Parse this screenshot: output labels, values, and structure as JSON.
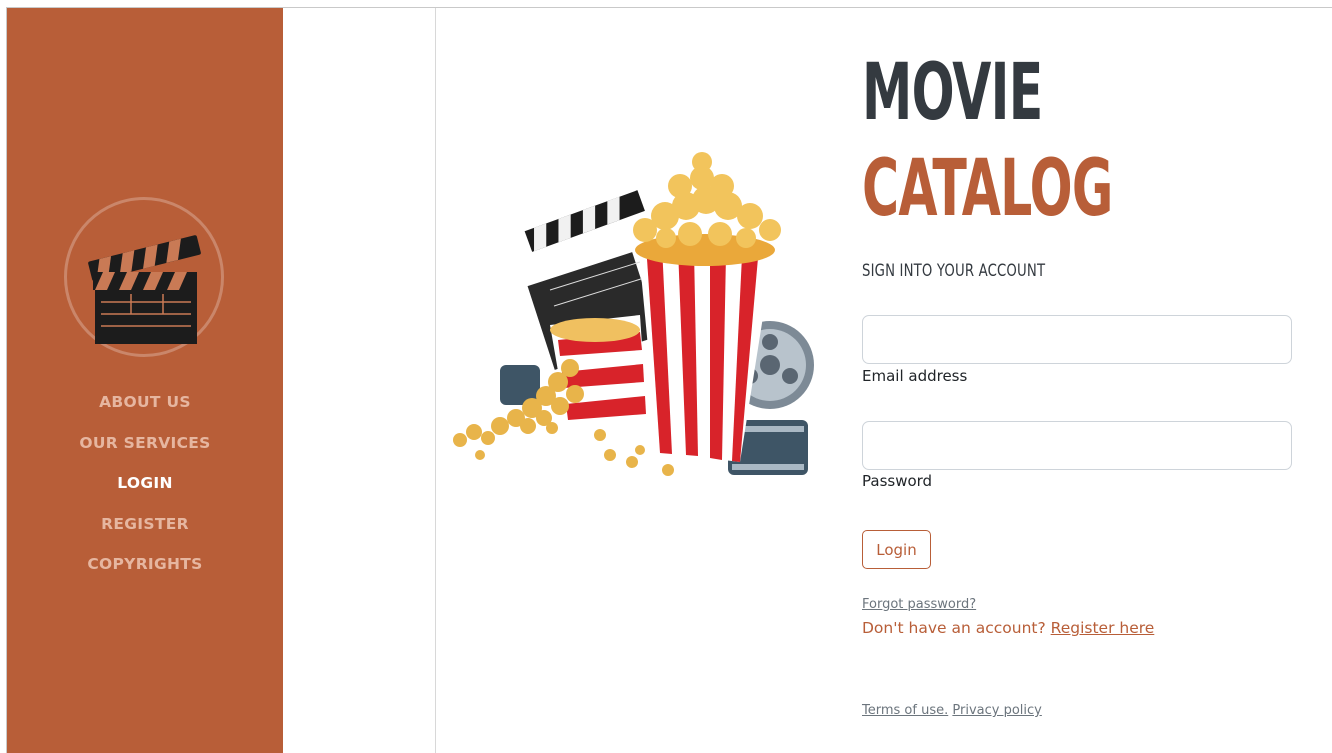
{
  "sidebar": {
    "logo_icon": "clapperboard-icon",
    "nav": [
      {
        "label": "ABOUT US",
        "active": false
      },
      {
        "label": "OUR SERVICES",
        "active": false
      },
      {
        "label": "LOGIN",
        "active": true
      },
      {
        "label": "REGISTER",
        "active": false
      },
      {
        "label": "COPYRIGHTS",
        "active": false
      }
    ]
  },
  "hero": {
    "image": "popcorn-clapperboard-film-reel-illustration"
  },
  "header": {
    "title_line1": "MOVIE",
    "title_line2": "CATALOG",
    "subtitle": "SIGN INTO YOUR ACCOUNT"
  },
  "form": {
    "email": {
      "value": "",
      "placeholder": "",
      "label": "Email address"
    },
    "password": {
      "value": "",
      "placeholder": "",
      "label": "Password"
    },
    "login_label": "Login",
    "forgot_label": "Forgot password?",
    "no_account_text": "Don't have an account? ",
    "register_link": "Register here"
  },
  "footer": {
    "terms": "Terms of use.",
    "privacy": "Privacy policy"
  },
  "colors": {
    "accent": "#b85e38",
    "title_dark": "#343a40",
    "nav_inactive": "#e6b6a0",
    "nav_active": "#ffffff"
  }
}
